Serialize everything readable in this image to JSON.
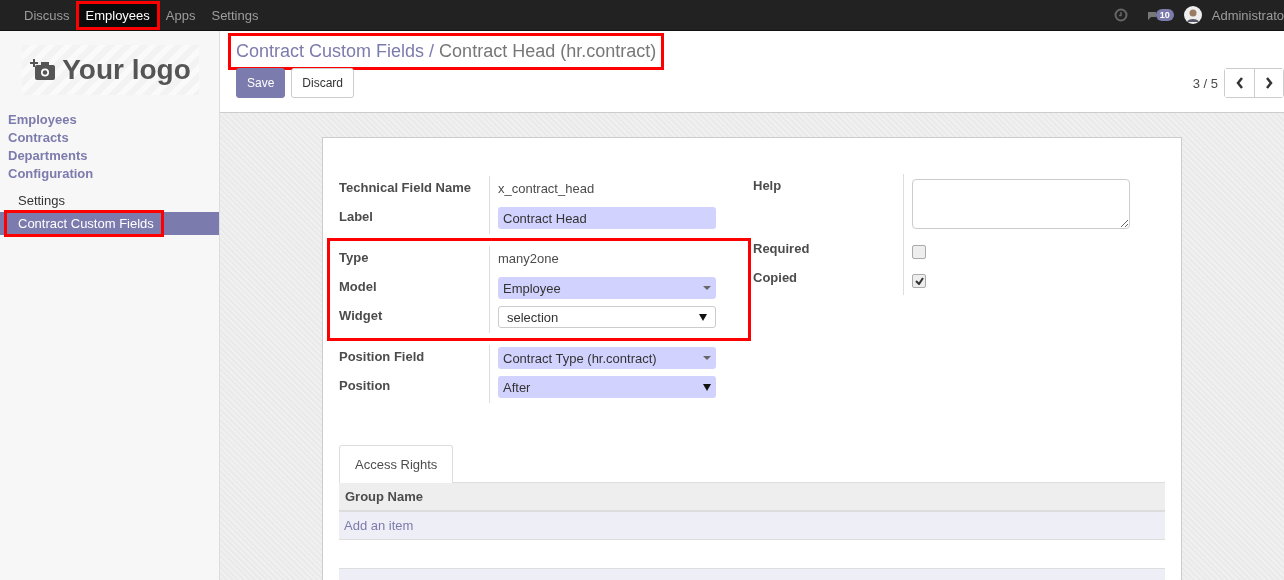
{
  "navbar": {
    "menus": [
      {
        "label": "Discuss",
        "selected": false,
        "highlighted": false
      },
      {
        "label": "Employees",
        "selected": true,
        "highlighted": true
      },
      {
        "label": "Apps",
        "selected": false,
        "highlighted": false
      },
      {
        "label": "Settings",
        "selected": false,
        "highlighted": false
      }
    ],
    "message_count": "10",
    "user": "Administrato"
  },
  "sidebar": {
    "logo": "Your logo",
    "sections": [
      {
        "label": "Employees"
      },
      {
        "label": "Contracts"
      },
      {
        "label": "Departments"
      },
      {
        "label": "Configuration"
      }
    ],
    "items": [
      {
        "label": "Settings",
        "selected": false,
        "highlighted": false
      },
      {
        "label": "Contract Custom Fields",
        "selected": true,
        "highlighted": true
      }
    ]
  },
  "breadcrumb": {
    "parent": "Contract Custom Fields",
    "separator": "/",
    "current": "Contract Head (hr.contract)",
    "highlighted": true
  },
  "buttons": [
    {
      "label": "Save",
      "kind": "primary"
    },
    {
      "label": "Discard",
      "kind": "secondary"
    }
  ],
  "pager": {
    "text": "3 / 5"
  },
  "form": {
    "left_groups": [
      {
        "highlighted": false,
        "fields": [
          {
            "label": "Technical Field Name",
            "kind": "text",
            "value": "x_contract_head"
          },
          {
            "label": "Label",
            "kind": "input",
            "value": "Contract Head"
          }
        ]
      },
      {
        "highlighted": true,
        "fields": [
          {
            "label": "Type",
            "kind": "text",
            "value": "many2one"
          },
          {
            "label": "Model",
            "kind": "many2one",
            "value": "Employee"
          },
          {
            "label": "Widget",
            "kind": "select",
            "value": "selection"
          }
        ]
      },
      {
        "highlighted": false,
        "fields": [
          {
            "label": "Position Field",
            "kind": "many2one",
            "value": "Contract Type (hr.contract)"
          },
          {
            "label": "Position",
            "kind": "select-required",
            "value": "After"
          }
        ]
      }
    ],
    "right_fields": [
      {
        "label": "Help",
        "kind": "textarea"
      },
      {
        "label": "Required",
        "kind": "checkbox",
        "checked": false
      },
      {
        "label": "Copied",
        "kind": "checkbox",
        "checked": true
      }
    ]
  },
  "notebook": {
    "tabs": [
      {
        "label": "Access Rights",
        "selected": true
      }
    ],
    "table": {
      "columns": [
        "Group Name"
      ],
      "add_link": "Add an item"
    }
  }
}
